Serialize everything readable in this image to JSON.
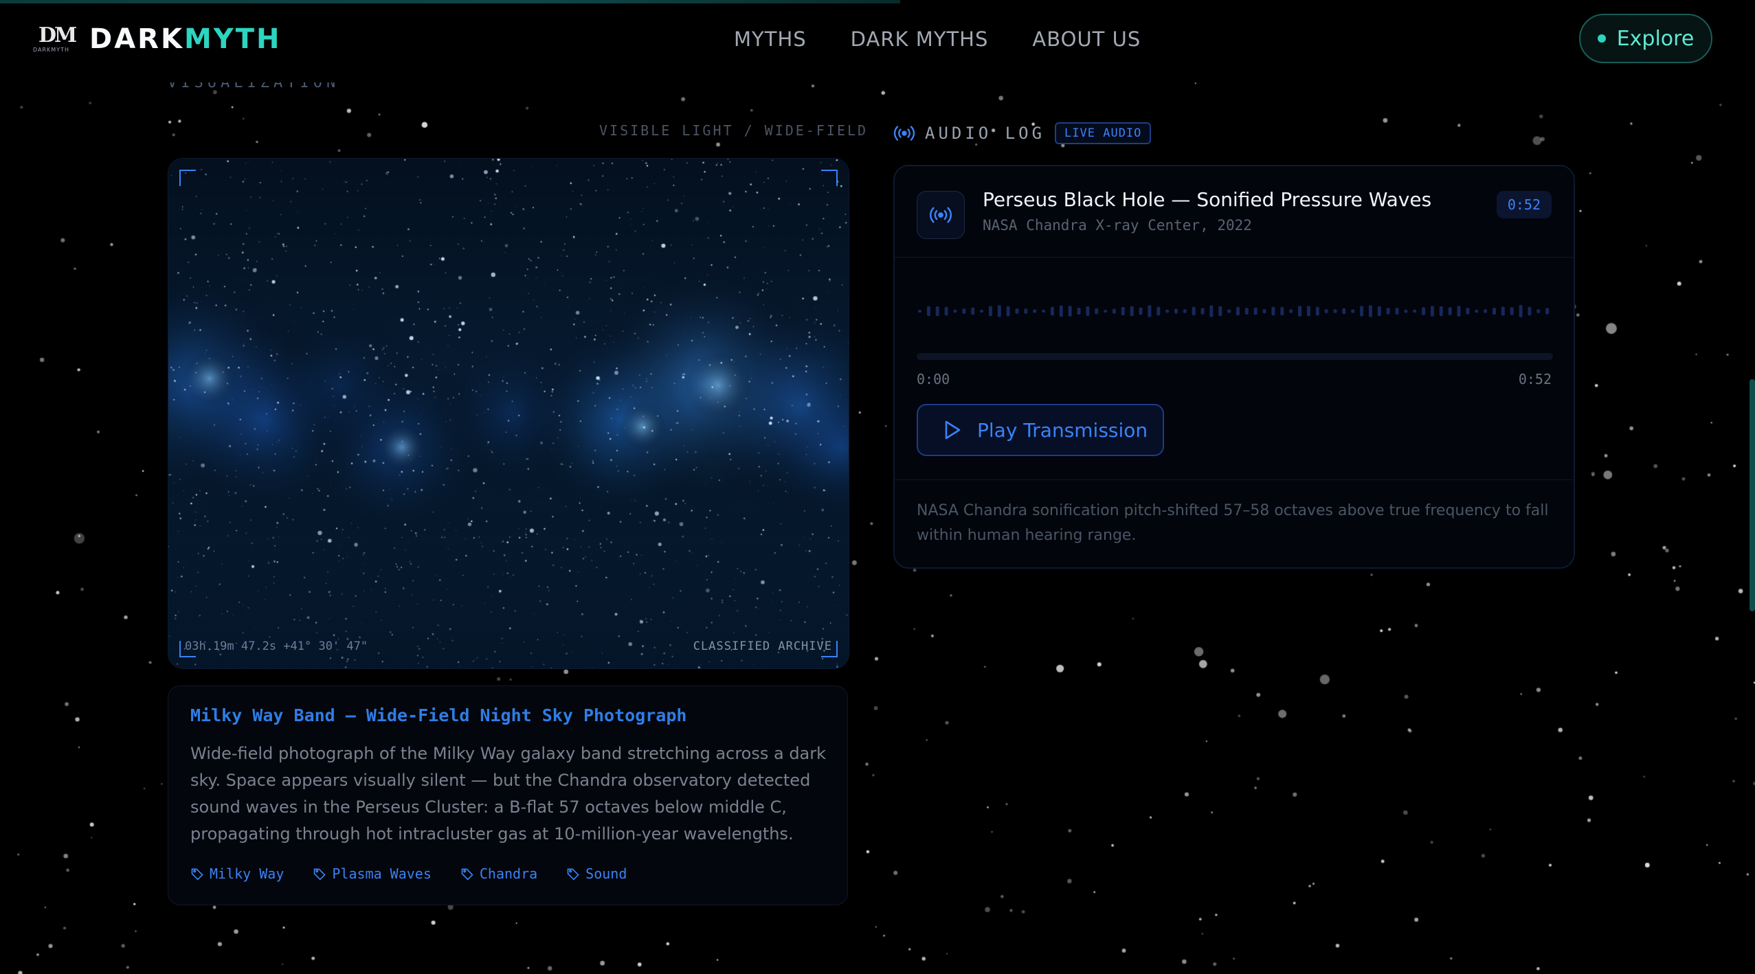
{
  "header": {
    "logo_mark": "DM",
    "logo_sub": "DARKMYTH",
    "brand_left": "DARK",
    "brand_right": "MYTH",
    "nav": [
      "MYTHS",
      "DARK MYTHS",
      "ABOUT US"
    ],
    "explore_label": "Explore"
  },
  "section": {
    "partial_label": "VISUALIZATION"
  },
  "visual": {
    "caption": "VISIBLE LIGHT / WIDE-FIELD",
    "coordinates": "03h 19m 47.2s +41° 30' 47\"",
    "archive_label": "CLASSIFIED ARCHIVE",
    "title": "Milky Way Band — Wide-Field Night Sky Photograph",
    "description": "Wide-field photograph of the Milky Way galaxy band stretching across a dark sky. Space appears visually silent — but the Chandra observatory detected sound waves in the Perseus Cluster: a B-flat 57 octaves below middle C, propagating through hot intracluster gas at 10-million-year wavelengths.",
    "tags": [
      "Milky Way",
      "Plasma Waves",
      "Chandra",
      "Sound"
    ]
  },
  "audio": {
    "header_label": "AUDIO LOG",
    "live_badge": "LIVE AUDIO",
    "track_title": "Perseus Black Hole — Sonified Pressure Waves",
    "track_source": "NASA Chandra X-ray Center, 2022",
    "duration": "0:52",
    "progress": 0,
    "time_start": "0:00",
    "time_end": "0:52",
    "play_label": "Play Transmission",
    "note": "NASA Chandra sonification pitch-shifted 57–58 octaves above true frequency to fall within human hearing range."
  },
  "colors": {
    "accent_teal": "#2dd4bf",
    "accent_blue": "#3b82f6",
    "background": "#000000"
  }
}
